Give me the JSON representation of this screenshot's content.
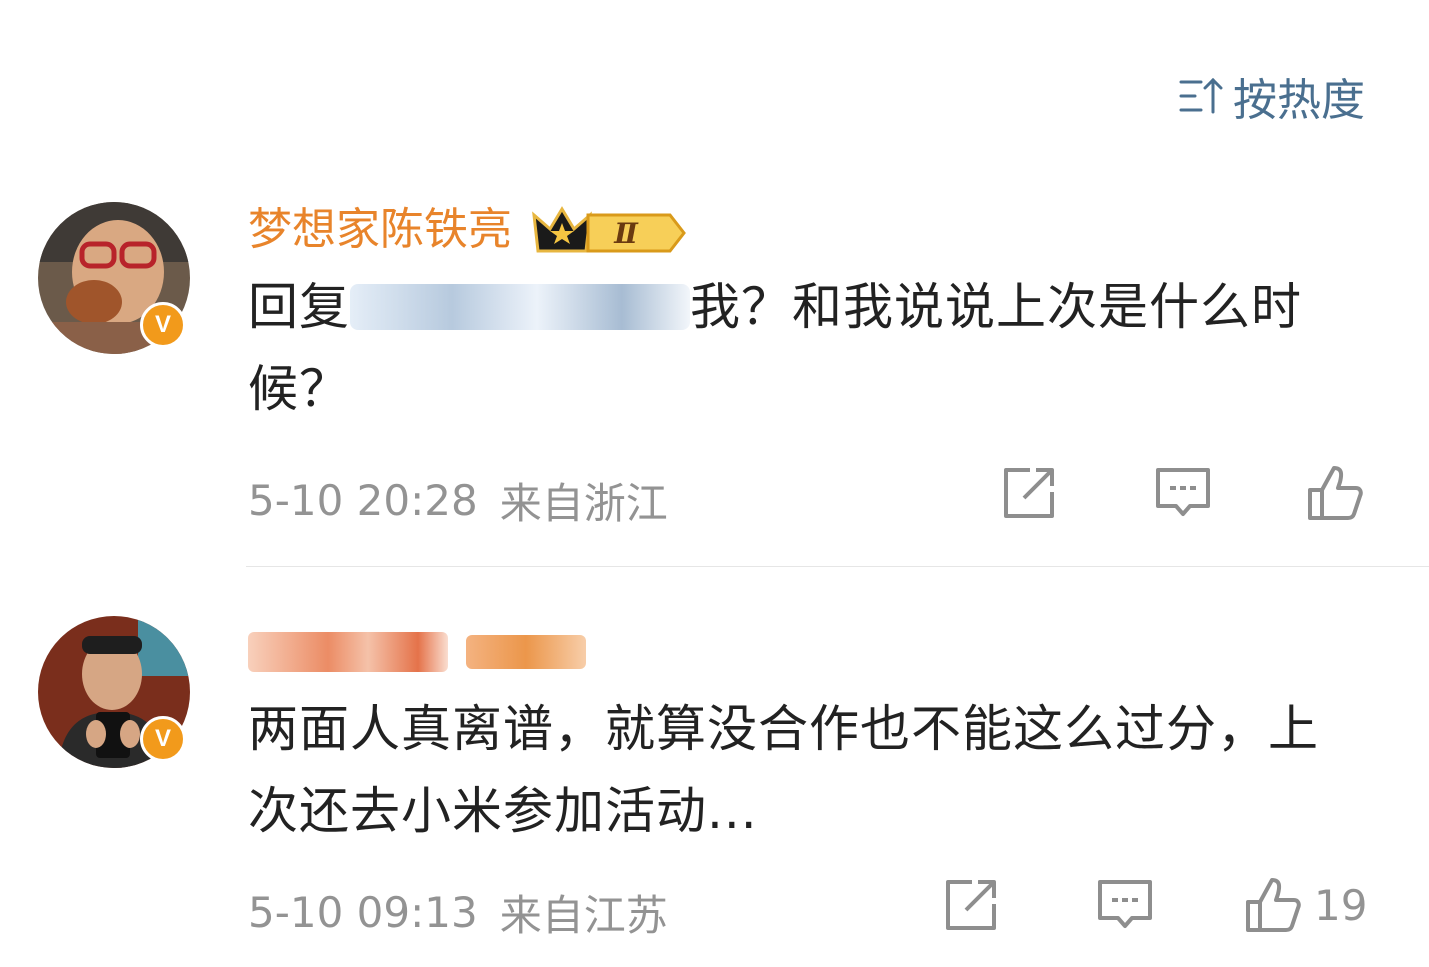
{
  "sort": {
    "label": "按热度",
    "icon": "sort-icon"
  },
  "comments": [
    {
      "username": "梦想家陈铁亮",
      "badge": "Ⅱ",
      "verified": "V",
      "reply_prefix": "回复",
      "reply_suffix": "我？和我说说上次是什么时候？",
      "time": "5-10 20:28",
      "location": "来自浙江",
      "like_count": ""
    },
    {
      "username": "",
      "verified": "V",
      "text": "两面人真离谱，就算没合作也不能这么过分，上次还去小米参加活动...",
      "time": "5-10 09:13",
      "location": "来自江苏",
      "like_count": "19"
    }
  ],
  "colors": {
    "accent": "#e8842b",
    "link": "#4a6f8f",
    "meta": "#939393",
    "text": "#222222"
  }
}
